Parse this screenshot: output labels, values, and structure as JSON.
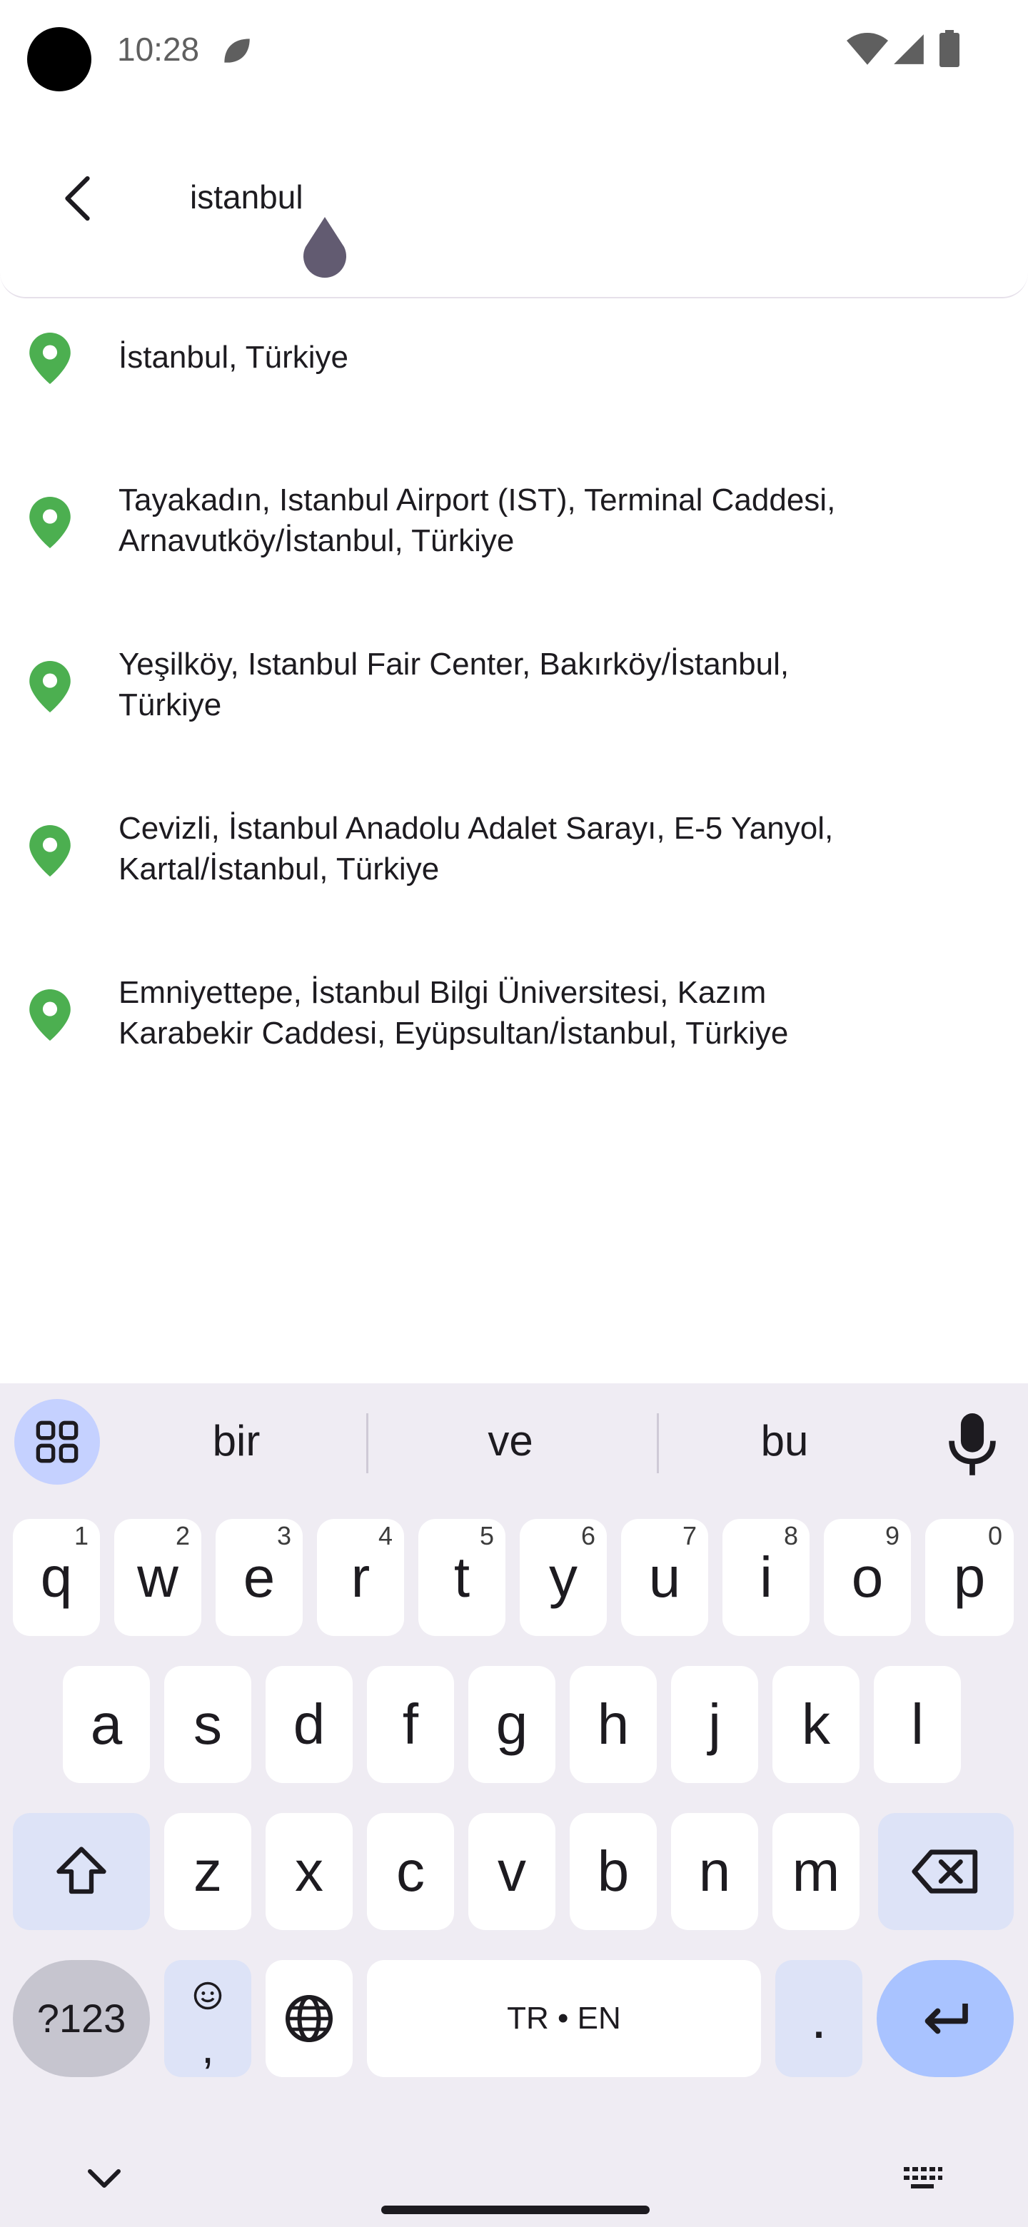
{
  "status_bar": {
    "time": "10:28"
  },
  "search": {
    "value": "istanbul"
  },
  "results": [
    {
      "lines": [
        "İstanbul, Türkiye"
      ]
    },
    {
      "lines": [
        "Tayakadın, Istanbul Airport (IST), Terminal Caddesi,",
        "Arnavutköy/İstanbul, Türkiye"
      ]
    },
    {
      "lines": [
        "Yeşilköy, Istanbul Fair Center, Bakırköy/İstanbul,",
        "Türkiye"
      ]
    },
    {
      "lines": [
        "Cevizli, İstanbul Anadolu Adalet Sarayı, E-5 Yanyol,",
        "Kartal/İstanbul, Türkiye"
      ]
    },
    {
      "lines": [
        "Emniyettepe, İstanbul Bilgi Üniversitesi, Kazım",
        "Karabekir Caddesi, Eyüpsultan/İstanbul, Türkiye"
      ]
    }
  ],
  "keyboard": {
    "suggestions": [
      "bir",
      "ve",
      "bu"
    ],
    "row1": [
      {
        "key": "q",
        "hint": "1"
      },
      {
        "key": "w",
        "hint": "2"
      },
      {
        "key": "e",
        "hint": "3"
      },
      {
        "key": "r",
        "hint": "4"
      },
      {
        "key": "t",
        "hint": "5"
      },
      {
        "key": "y",
        "hint": "6"
      },
      {
        "key": "u",
        "hint": "7"
      },
      {
        "key": "i",
        "hint": "8"
      },
      {
        "key": "o",
        "hint": "9"
      },
      {
        "key": "p",
        "hint": "0"
      }
    ],
    "row2": [
      "a",
      "s",
      "d",
      "f",
      "g",
      "h",
      "j",
      "k",
      "l"
    ],
    "row3": [
      "z",
      "x",
      "c",
      "v",
      "b",
      "n",
      "m"
    ],
    "symbols_label": "?123",
    "emoji_comma_label": ",",
    "space_label": "TR • EN",
    "period_label": "."
  },
  "colors": {
    "pin": "#4caf50",
    "accent": "#a9c3ff",
    "keyboard_bg": "#efecf3"
  }
}
